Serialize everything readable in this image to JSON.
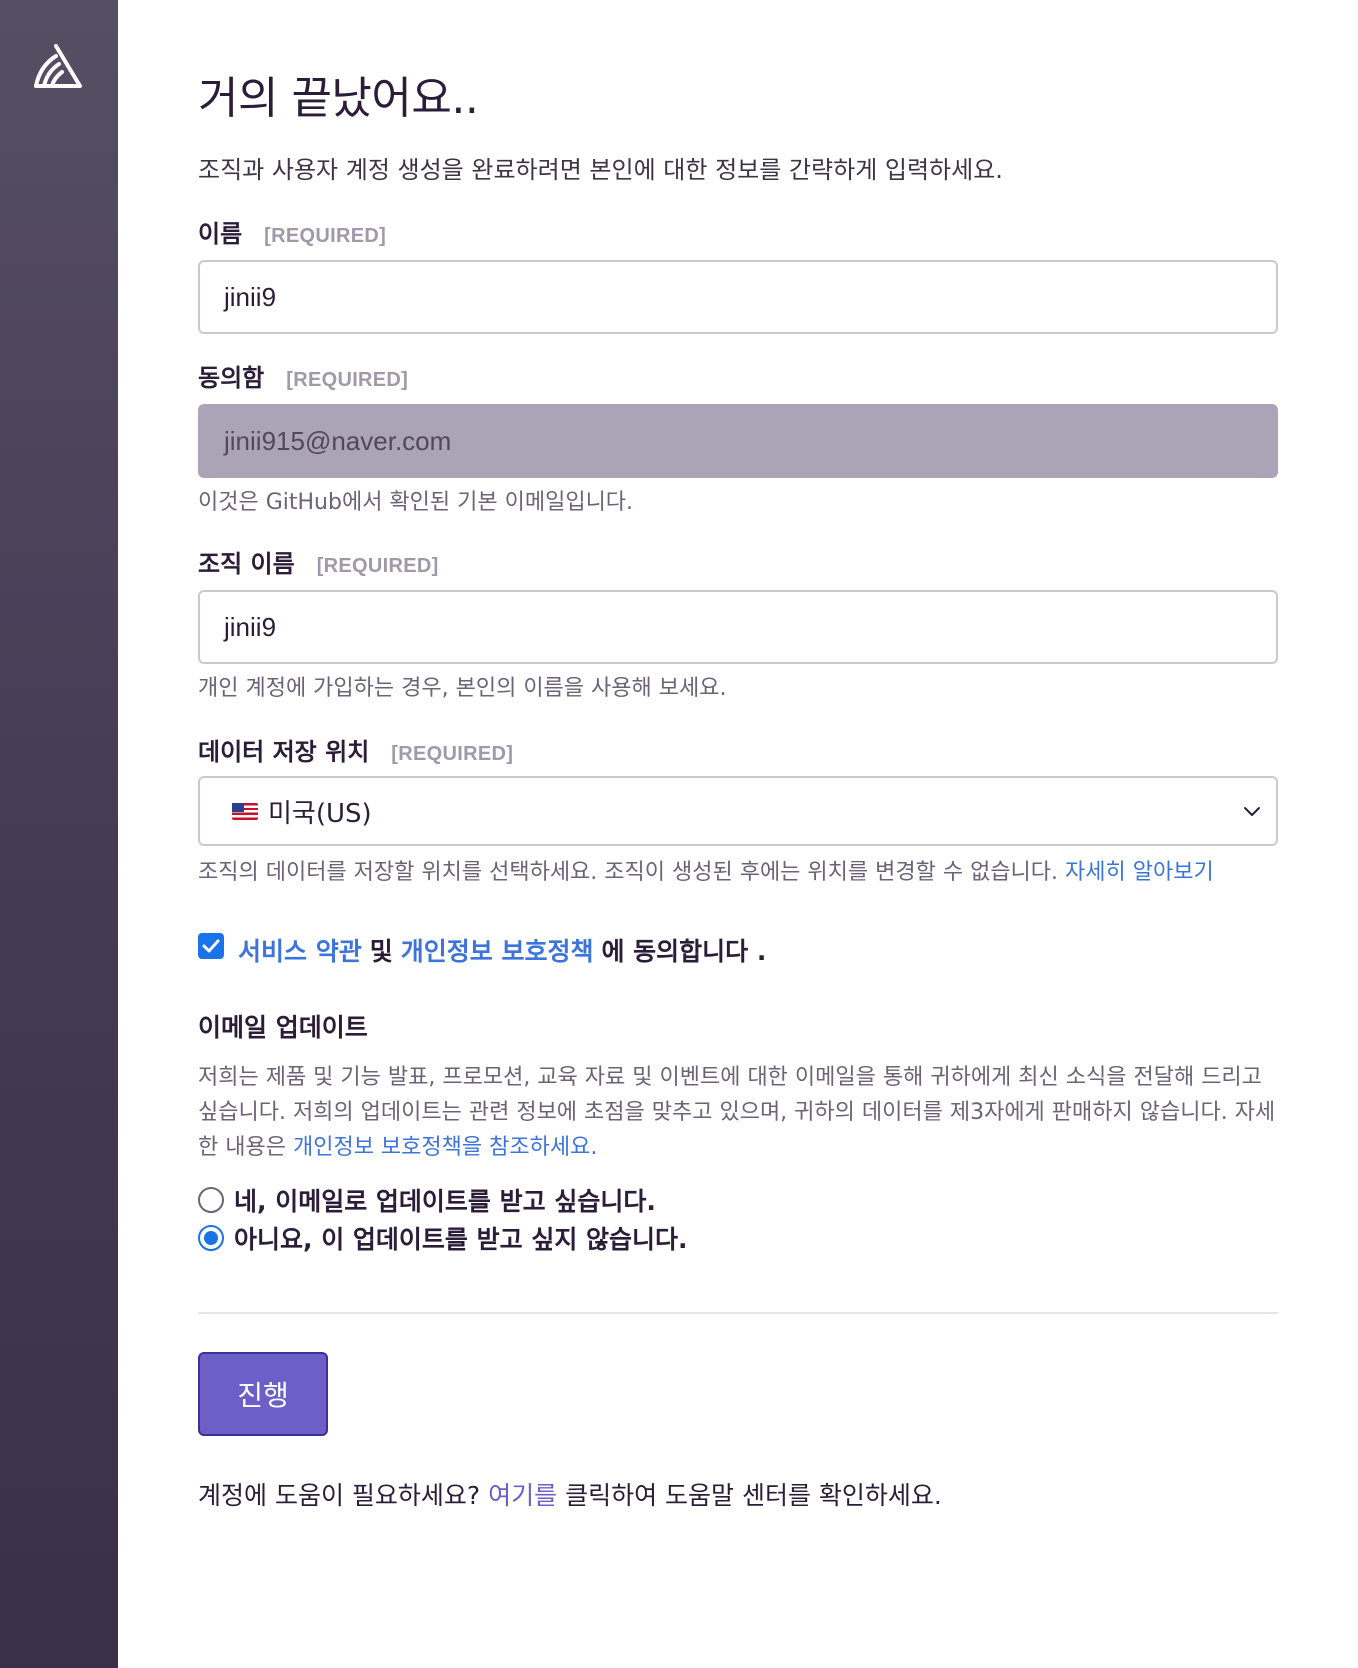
{
  "page": {
    "title": "거의 끝났어요..",
    "subtitle": "조직과 사용자 계정 생성을 완료하려면 본인에 대한 정보를 간략하게 입력하세요."
  },
  "fields": {
    "name": {
      "label": "이름",
      "required": "[REQUIRED]",
      "value": "jinii9"
    },
    "email": {
      "label": "동의함",
      "required": "[REQUIRED]",
      "value": "jinii915@naver.com",
      "help": "이것은 GitHub에서 확인된 기본 이메일입니다."
    },
    "org": {
      "label": "조직 이름",
      "required": "[REQUIRED]",
      "value": "jinii9",
      "help": "개인 계정에 가입하는 경우, 본인의 이름을 사용해 보세요."
    },
    "storage": {
      "label": "데이터 저장 위치",
      "required": "[REQUIRED]",
      "selected": "미국(US)",
      "help": "조직의 데이터를 저장할 위치를 선택하세요. 조직이 생성된 후에는 위치를 변경할 수 없습니다.",
      "help_link": "자세히 알아보기"
    }
  },
  "agreement": {
    "terms_link": "서비스 약관",
    "and": "및",
    "privacy_link": "개인정보 보호정책",
    "suffix": "에 동의합니다 .",
    "checked": true
  },
  "email_updates": {
    "title": "이메일 업데이트",
    "description": "저희는 제품 및 기능 발표, 프로모션, 교육 자료 및 이벤트에 대한 이메일을 통해 귀하에게 최신 소식을 전달해 드리고 싶습니다. 저희의 업데이트는 관련 정보에 초점을 맞추고 있으며, 귀하의 데이터를 제3자에게 판매하지 않습니다. 자세한 내용은",
    "description_link": "개인정보 보호정책을 참조하세요.",
    "options": [
      {
        "label": "네, 이메일로 업데이트를 받고 싶습니다.",
        "checked": false
      },
      {
        "label": "아니요, 이 업데이트를 받고 싶지 않습니다.",
        "checked": true
      }
    ]
  },
  "submit": {
    "label": "진행"
  },
  "footer": {
    "prefix": "계정에 도움이 필요하세요?",
    "link": "여기를",
    "suffix": "클릭하여 도움말 센터를 확인하세요."
  },
  "colors": {
    "sidebar": "#463b55",
    "accent": "#6c5fc7",
    "link": "#3d74db",
    "check": "#1a73e8"
  }
}
